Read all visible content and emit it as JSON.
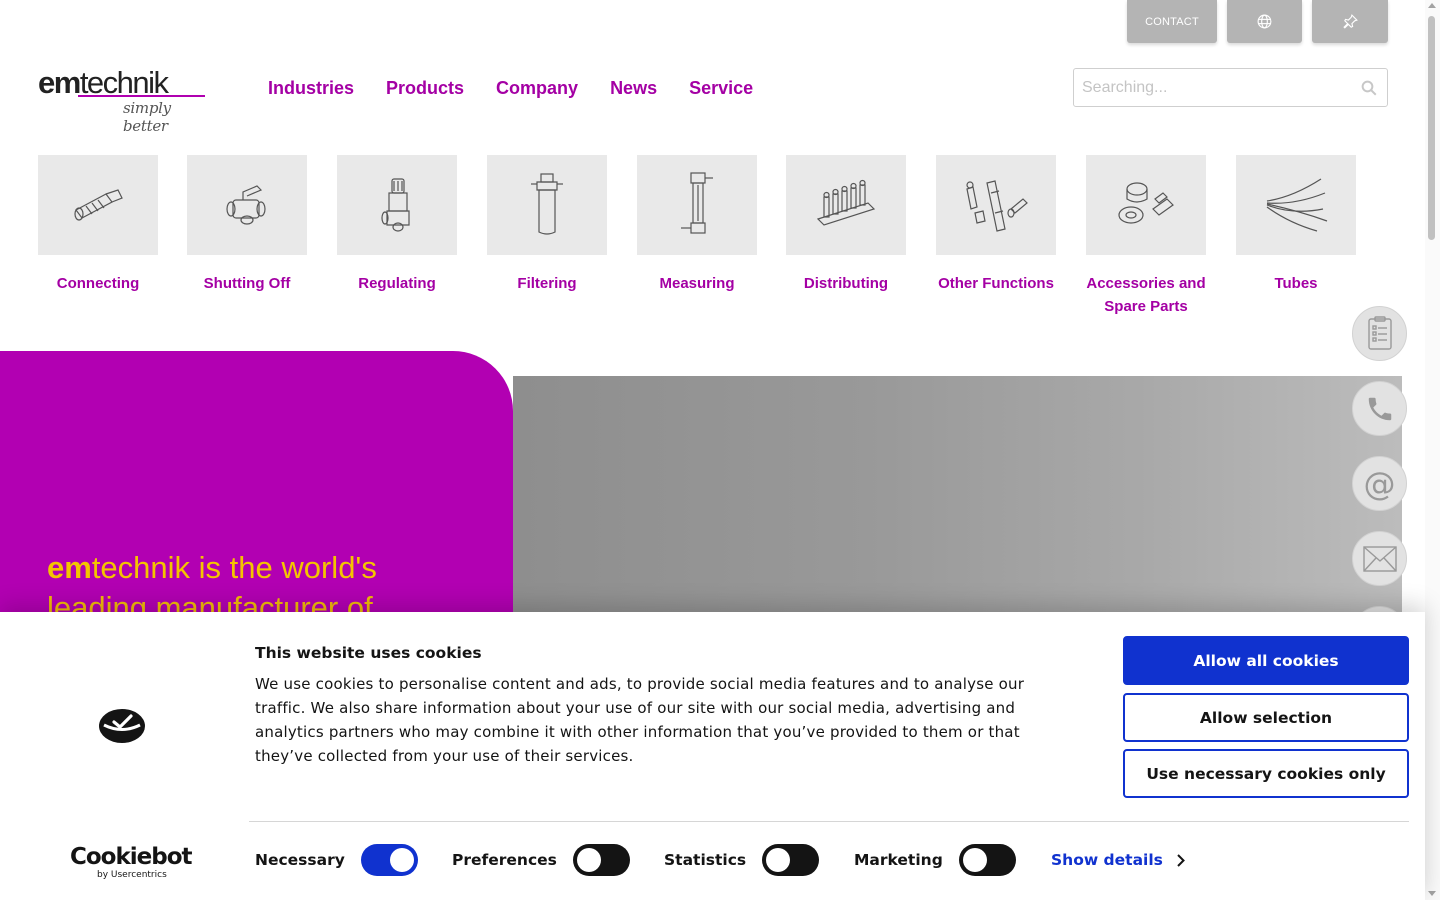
{
  "utility": {
    "contact_label": "CONTACT",
    "globe_icon": "globe-icon",
    "pin_icon": "pin-icon"
  },
  "logo": {
    "word_bold": "em",
    "word_regular": "technik",
    "tagline": "simply better",
    "brand_color": "#a400a4"
  },
  "nav": {
    "items": [
      "Industries",
      "Products",
      "Company",
      "News",
      "Service"
    ]
  },
  "search": {
    "placeholder": "Searching...",
    "value": ""
  },
  "categories": [
    {
      "label": "Connecting",
      "icon": "connector-fitting-icon"
    },
    {
      "label": "Shutting Off",
      "icon": "ball-valve-icon"
    },
    {
      "label": "Regulating",
      "icon": "regulating-valve-icon"
    },
    {
      "label": "Filtering",
      "icon": "filter-cartridge-icon"
    },
    {
      "label": "Measuring",
      "icon": "flow-meter-icon"
    },
    {
      "label": "Distributing",
      "icon": "manifold-icon"
    },
    {
      "label": "Other Functions",
      "icon": "misc-components-icon"
    },
    {
      "label": "Accessories and Spare Parts",
      "icon": "accessories-icon"
    },
    {
      "label": "Tubes",
      "icon": "tubes-icon"
    }
  ],
  "hero": {
    "headline_bold": "em",
    "headline_rest": "technik is the world's",
    "headline_line2": "leading manufacturer of",
    "accent_color": "#b200b2",
    "text_color": "#f4c400"
  },
  "side_actions": [
    {
      "name": "checklist-icon"
    },
    {
      "name": "phone-icon"
    },
    {
      "name": "at-sign-icon"
    },
    {
      "name": "envelope-icon"
    }
  ],
  "cookie": {
    "title": "This website uses cookies",
    "body": "We use cookies to personalise content and ads, to provide social media features and to analyse our traffic. We also share information about your use of our site with our social media, advertising and analytics partners who may combine it with other information that you’ve provided to them or that they’ve collected from your use of their services.",
    "allow_all": "Allow all cookies",
    "allow_selection": "Allow selection",
    "necessary_only": "Use necessary cookies only",
    "toggles": [
      {
        "label": "Necessary",
        "on": true
      },
      {
        "label": "Preferences",
        "on": false
      },
      {
        "label": "Statistics",
        "on": false
      },
      {
        "label": "Marketing",
        "on": false
      }
    ],
    "show_details": "Show details",
    "brand_name": "Cookiebot",
    "brand_by": "by Usercentrics",
    "button_color": "#1032cf"
  }
}
